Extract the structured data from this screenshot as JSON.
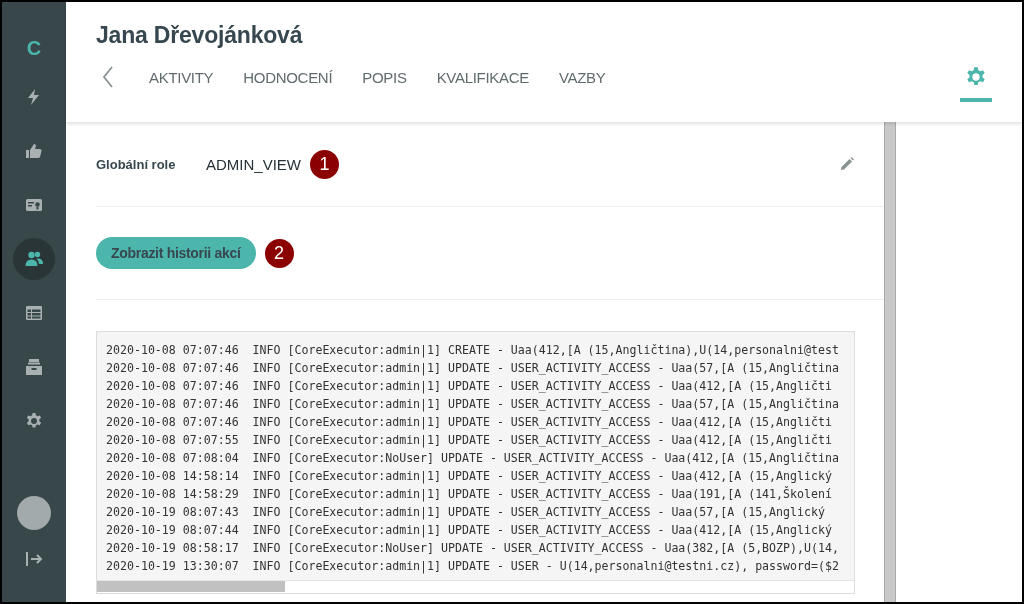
{
  "sidebar": {
    "logo": "C",
    "items": [
      {
        "kind": "bolt",
        "selected": false
      },
      {
        "kind": "thumb",
        "selected": false
      },
      {
        "kind": "card",
        "selected": false
      },
      {
        "kind": "people",
        "selected": true
      },
      {
        "kind": "table",
        "selected": false
      },
      {
        "kind": "archive",
        "selected": false
      },
      {
        "kind": "gear",
        "selected": false
      }
    ]
  },
  "header": {
    "title": "Jana Dřevojánková",
    "tabs": [
      {
        "label": "AKTIVITY",
        "selected": false
      },
      {
        "label": "HODNOCENÍ",
        "selected": false
      },
      {
        "label": "POPIS",
        "selected": false
      },
      {
        "label": "KVALIFIKACE",
        "selected": false
      },
      {
        "label": "VAZBY",
        "selected": false
      }
    ],
    "settings_tab": {
      "selected": true
    }
  },
  "role": {
    "label": "Globální role",
    "value": "ADMIN_VIEW",
    "marker": "1"
  },
  "history": {
    "button": "Zobrazit historii akcí",
    "marker": "2"
  },
  "log": {
    "lines": [
      "2020-10-08 07:07:46  INFO [CoreExecutor:admin|1] CREATE - Uaa(412,[A (15,Angličtina),U(14,personalni@test",
      "2020-10-08 07:07:46  INFO [CoreExecutor:admin|1] UPDATE - USER_ACTIVITY_ACCESS - Uaa(57,[A (15,Angličtina",
      "2020-10-08 07:07:46  INFO [CoreExecutor:admin|1] UPDATE - USER_ACTIVITY_ACCESS - Uaa(412,[A (15,Angličti",
      "2020-10-08 07:07:46  INFO [CoreExecutor:admin|1] UPDATE - USER_ACTIVITY_ACCESS - Uaa(57,[A (15,Angličtina",
      "2020-10-08 07:07:46  INFO [CoreExecutor:admin|1] UPDATE - USER_ACTIVITY_ACCESS - Uaa(412,[A (15,Angličti",
      "2020-10-08 07:07:55  INFO [CoreExecutor:admin|1] UPDATE - USER_ACTIVITY_ACCESS - Uaa(412,[A (15,Angličti",
      "2020-10-08 07:08:04  INFO [CoreExecutor:NoUser] UPDATE - USER_ACTIVITY_ACCESS - Uaa(412,[A (15,Angličtina",
      "2020-10-08 14:58:14  INFO [CoreExecutor:admin|1] UPDATE - USER_ACTIVITY_ACCESS - Uaa(412,[A (15,Anglický",
      "2020-10-08 14:58:29  INFO [CoreExecutor:admin|1] UPDATE - USER_ACTIVITY_ACCESS - Uaa(191,[A (141,Školení",
      "2020-10-19 08:07:43  INFO [CoreExecutor:admin|1] UPDATE - USER_ACTIVITY_ACCESS - Uaa(57,[A (15,Anglický",
      "2020-10-19 08:07:44  INFO [CoreExecutor:admin|1] UPDATE - USER_ACTIVITY_ACCESS - Uaa(412,[A (15,Anglický",
      "2020-10-19 08:58:17  INFO [CoreExecutor:NoUser] UPDATE - USER_ACTIVITY_ACCESS - Uaa(382,[A (5,BOZP),U(14,",
      "2020-10-19 13:30:07  INFO [CoreExecutor:admin|1] UPDATE - USER - U(14,personalni@testni.cz), password=($2"
    ]
  }
}
